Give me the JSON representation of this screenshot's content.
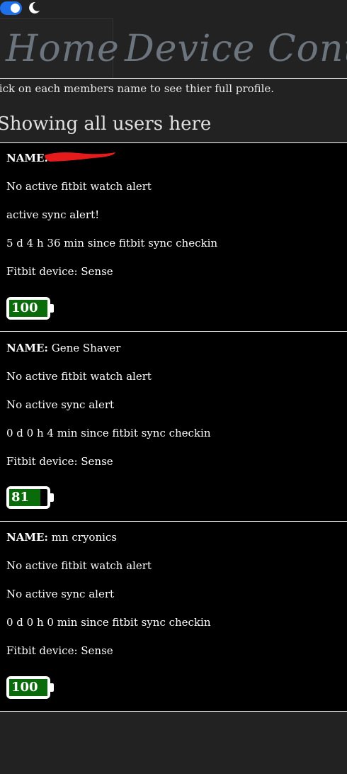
{
  "theme_toggle": {
    "state": "on",
    "accent": "#1f6feb"
  },
  "nav": {
    "home_label": "Home",
    "device_label": "Device Contro"
  },
  "intro_text": "lick on each members name to see thier full profile.",
  "heading": "Showing all users here",
  "users": [
    {
      "name_label": "NAME:",
      "name": "",
      "watch_alert": "No active fitbit watch alert",
      "sync_alert": "active sync alert!",
      "checkin": "5 d 4 h 36 min since fitbit sync checkin",
      "device": "Fitbit device: Sense",
      "battery": "100",
      "battery_level": 1.0
    },
    {
      "name_label": "NAME:",
      "name": "Gene Shaver",
      "watch_alert": "No active fitbit watch alert",
      "sync_alert": "No active sync alert",
      "checkin": "0 d 0 h 4 min since fitbit sync checkin",
      "device": "Fitbit device: Sense",
      "battery": "81",
      "battery_level": 0.81
    },
    {
      "name_label": "NAME:",
      "name": "mn cryonics",
      "watch_alert": "No active fitbit watch alert",
      "sync_alert": "No active sync alert",
      "checkin": "0 d 0 h 0 min since fitbit sync checkin",
      "device": "Fitbit device: Sense",
      "battery": "100",
      "battery_level": 1.0
    }
  ],
  "colors": {
    "background": "#222222",
    "card": "#000000",
    "battery_fill": "#0a6b0a",
    "nav_text": "#6c757d"
  }
}
